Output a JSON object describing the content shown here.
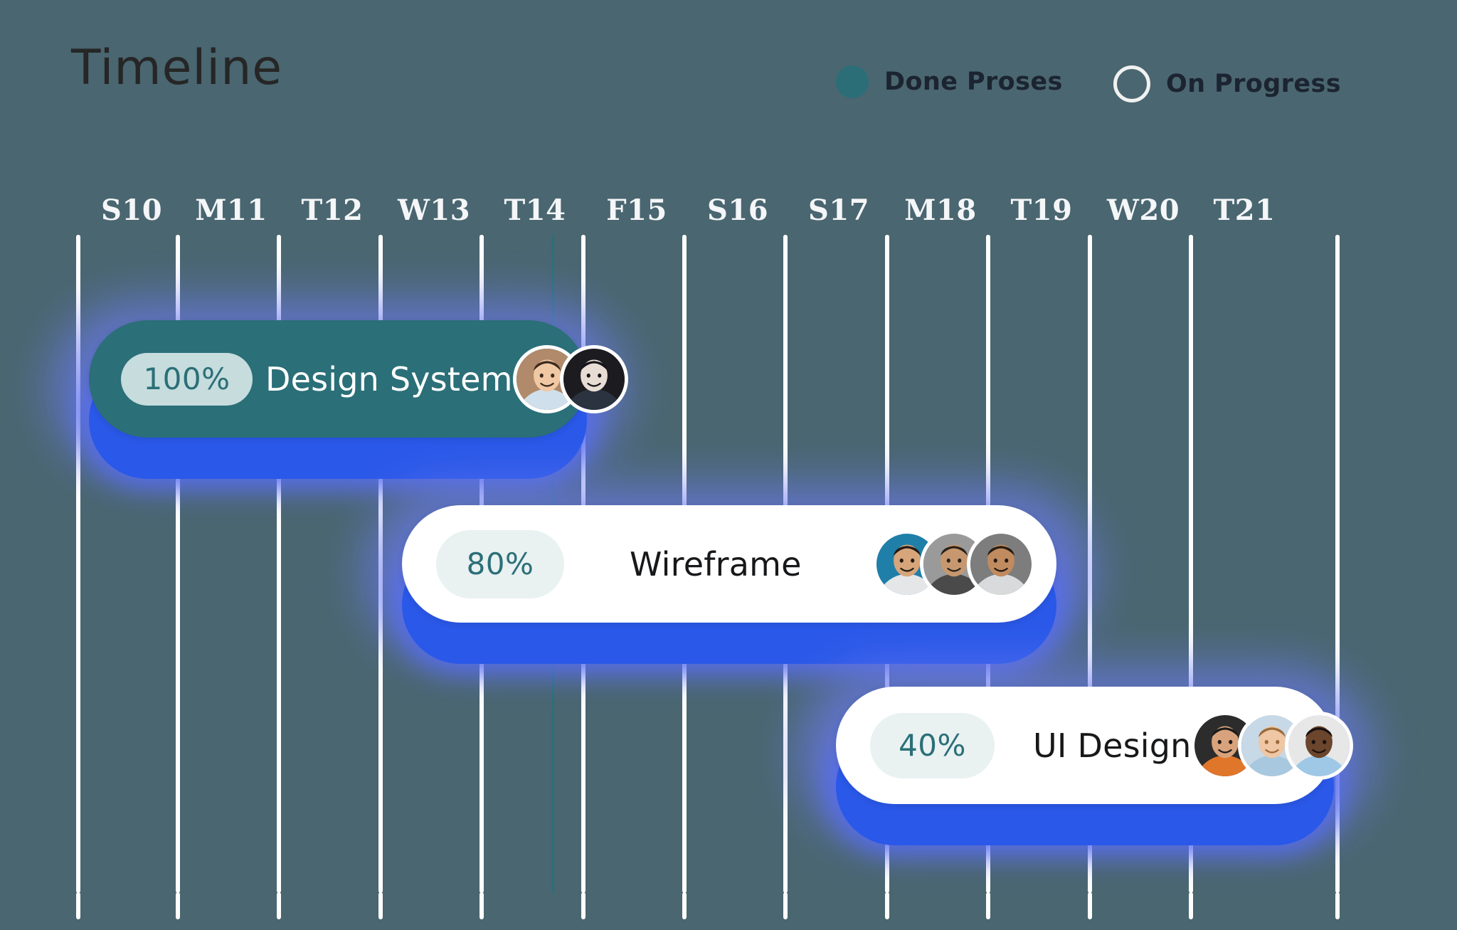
{
  "page": {
    "title": "Timeline",
    "background_color": "#4a6670"
  },
  "legend": {
    "items": [
      {
        "label": "Done Proses",
        "marker": "filled-circle",
        "color": "#2b6e77"
      },
      {
        "label": "On Progress",
        "marker": "hollow-circle",
        "color": "#f1f1f1"
      }
    ]
  },
  "timeline": {
    "columns": [
      {
        "label": "S10"
      },
      {
        "label": "M11"
      },
      {
        "label": "T12"
      },
      {
        "label": "W13"
      },
      {
        "label": "T14"
      },
      {
        "label": "F15"
      },
      {
        "label": "S16"
      },
      {
        "label": "S17"
      },
      {
        "label": "M18"
      },
      {
        "label": "T19"
      },
      {
        "label": "W20"
      },
      {
        "label": "T21"
      }
    ],
    "today_marker": {
      "column": "T14",
      "color": "#2e6f78"
    },
    "gridline_color": "#ffffff"
  },
  "tasks": [
    {
      "name": "Design System",
      "progress": "100%",
      "status": "Done Proses",
      "bar_color": "#2b6f78",
      "pill_color": "#c6dcdd",
      "shadow_color": "#2a58e8",
      "start_column": "S10",
      "end_column": "T14",
      "avatars": [
        {
          "name": "avatar-bearded-man"
        },
        {
          "name": "avatar-person-hat-sunglasses"
        }
      ]
    },
    {
      "name": "Wireframe",
      "progress": "80%",
      "status": "On Progress",
      "bar_color": "#ffffff",
      "pill_color": "#e9f1f1",
      "shadow_color": "#2a58e8",
      "start_column": "W13",
      "end_column": "T19",
      "avatars": [
        {
          "name": "avatar-man-glasses-beard"
        },
        {
          "name": "avatar-bald-man"
        },
        {
          "name": "avatar-smiling-man-glasses"
        }
      ]
    },
    {
      "name": "UI Design",
      "progress": "40%",
      "status": "On Progress",
      "bar_color": "#ffffff",
      "pill_color": "#e9f1f1",
      "shadow_color": "#2a58e8",
      "start_column": "S17",
      "end_column": "T21",
      "avatars": [
        {
          "name": "avatar-woman-headscarf"
        },
        {
          "name": "avatar-smiling-man-blue-shirt"
        },
        {
          "name": "avatar-man-light-blue-shirt"
        }
      ]
    }
  ]
}
